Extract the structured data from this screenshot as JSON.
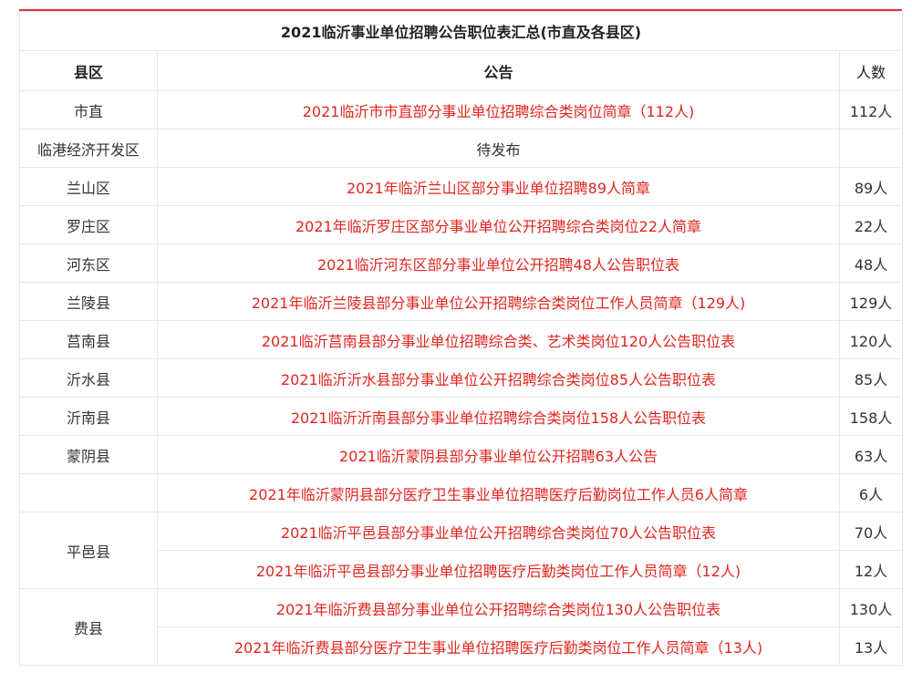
{
  "table": {
    "title": "2021临沂事业单位招聘公告职位表汇总(市直及各县区)",
    "headers": {
      "county": "县区",
      "notice": "公告",
      "count": "人数"
    },
    "rows": [
      {
        "county": "市直",
        "notice": "2021临沂市市直部分事业单位招聘综合类岗位简章（112人)",
        "count": "112人",
        "link": true
      },
      {
        "county": "临港经济开发区",
        "notice": "待发布",
        "count": "",
        "link": false
      },
      {
        "county": "兰山区",
        "notice": "2021年临沂兰山区部分事业单位招聘89人简章",
        "count": "89人",
        "link": true
      },
      {
        "county": "罗庄区",
        "notice": "2021年临沂罗庄区部分事业单位公开招聘综合类岗位22人简章",
        "count": "22人",
        "link": true
      },
      {
        "county": "河东区",
        "notice": "2021临沂河东区部分事业单位公开招聘48人公告职位表",
        "count": "48人",
        "link": true
      },
      {
        "county": "兰陵县",
        "notice": "2021年临沂兰陵县部分事业单位公开招聘综合类岗位工作人员简章（129人)",
        "count": "129人",
        "link": true
      },
      {
        "county": "莒南县",
        "notice": "2021临沂莒南县部分事业单位招聘综合类、艺术类岗位120人公告职位表",
        "count": "120人",
        "link": true
      },
      {
        "county": "沂水县",
        "notice": "2021临沂沂水县部分事业单位公开招聘综合类岗位85人公告职位表",
        "count": "85人",
        "link": true
      },
      {
        "county": "沂南县",
        "notice": "2021临沂沂南县部分事业单位招聘综合类岗位158人公告职位表",
        "count": "158人",
        "link": true
      },
      {
        "county": "蒙阴县",
        "notice": "2021临沂蒙阴县部分事业单位公开招聘63人公告",
        "count": "63人",
        "link": true
      },
      {
        "county": "",
        "notice": "2021年临沂蒙阴县部分医疗卫生事业单位招聘医疗后勤岗位工作人员6人简章",
        "count": "6人",
        "link": true
      }
    ],
    "pingyi": {
      "county": "平邑县",
      "items": [
        {
          "notice": "2021临沂平邑县部分事业单位公开招聘综合类岗位70人公告职位表",
          "count": "70人"
        },
        {
          "notice": "2021年临沂平邑县部分事业单位招聘医疗后勤类岗位工作人员简章（12人)",
          "count": "12人"
        }
      ]
    },
    "feixian": {
      "county": "费县",
      "items": [
        {
          "notice": "2021年临沂费县部分事业单位公开招聘综合类岗位130人公告职位表",
          "count": "130人"
        },
        {
          "notice": "2021年临沂费县部分医疗卫生事业单位招聘医疗后勤类岗位工作人员简章（13人)",
          "count": "13人"
        }
      ]
    },
    "colors": {
      "link": "#e0261f",
      "accent_top_border": "#d9363e",
      "grid": "#e6e6e6"
    }
  }
}
